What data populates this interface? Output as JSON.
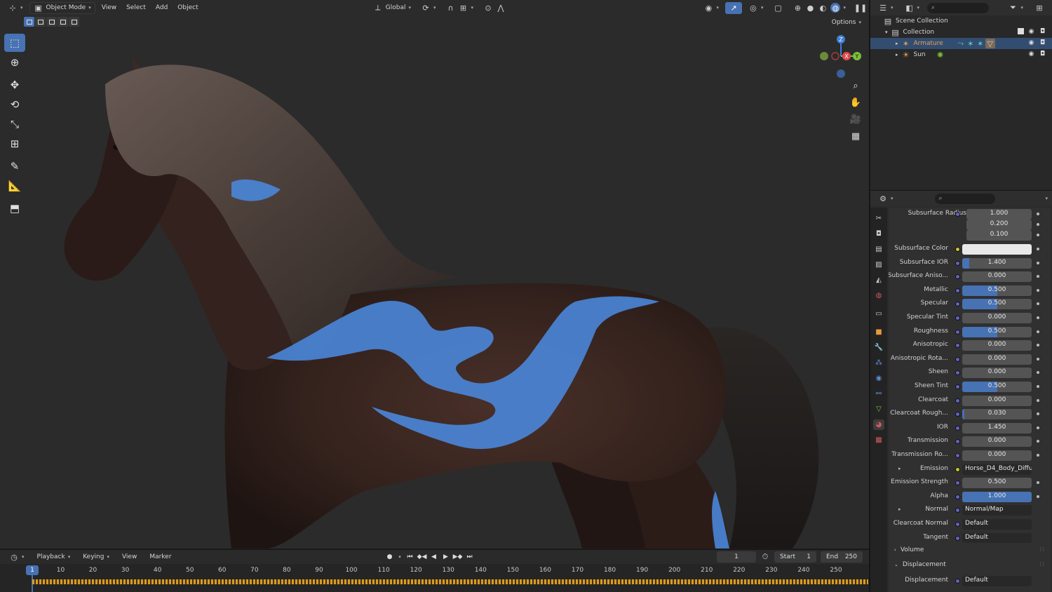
{
  "viewport": {
    "mode": "Object Mode",
    "menus": [
      "View",
      "Select",
      "Add",
      "Object"
    ],
    "orientation": "Global",
    "options_label": "Options",
    "gizmo": {
      "z": "Z",
      "x": "X",
      "y": "Y"
    }
  },
  "tools": [
    "select-box",
    "cursor",
    "move",
    "rotate",
    "scale",
    "transform",
    "annotate",
    "measure",
    "add-cube"
  ],
  "timeline": {
    "menus": [
      "Playback",
      "Keying",
      "View",
      "Marker"
    ],
    "current_frame": "1",
    "start_label": "Start",
    "start_value": "1",
    "end_label": "End",
    "end_value": "250",
    "frame_ticks": [
      "10",
      "20",
      "30",
      "40",
      "50",
      "60",
      "70",
      "80",
      "90",
      "100",
      "110",
      "120",
      "130",
      "140",
      "150",
      "160",
      "170",
      "180",
      "190",
      "200",
      "210",
      "220",
      "230",
      "240",
      "250"
    ]
  },
  "outliner": {
    "scene_collection": "Scene Collection",
    "collection": "Collection",
    "armature": "Armature",
    "sun": "Sun"
  },
  "properties": {
    "subsurface_radius_label": "Subsurface Radius",
    "subsurface_radius": [
      "1.000",
      "0.200",
      "0.100"
    ],
    "rows": [
      {
        "label": "Subsurface Color",
        "value": "",
        "kind": "color",
        "dot": "yellow"
      },
      {
        "label": "Subsurface IOR",
        "value": "1.400",
        "fill": 0.1
      },
      {
        "label": "Subsurface Aniso...",
        "value": "0.000",
        "fill": 0
      },
      {
        "label": "Metallic",
        "value": "0.500",
        "fill": 0.5
      },
      {
        "label": "Specular",
        "value": "0.500",
        "fill": 0.5
      },
      {
        "label": "Specular Tint",
        "value": "0.000",
        "fill": 0
      },
      {
        "label": "Roughness",
        "value": "0.500",
        "fill": 0.5
      },
      {
        "label": "Anisotropic",
        "value": "0.000",
        "fill": 0
      },
      {
        "label": "Anisotropic Rota...",
        "value": "0.000",
        "fill": 0
      },
      {
        "label": "Sheen",
        "value": "0.000",
        "fill": 0
      },
      {
        "label": "Sheen Tint",
        "value": "0.500",
        "fill": 0.5
      },
      {
        "label": "Clearcoat",
        "value": "0.000",
        "fill": 0
      },
      {
        "label": "Clearcoat Rough...",
        "value": "0.030",
        "fill": 0.03
      },
      {
        "label": "IOR",
        "value": "1.450",
        "fill": 0
      },
      {
        "label": "Transmission",
        "value": "0.000",
        "fill": 0
      },
      {
        "label": "Transmission Ro...",
        "value": "0.000",
        "fill": 0
      },
      {
        "label": "Emission",
        "value": "Horse_D4_Body_Diffuse",
        "kind": "link",
        "dot": "yellow",
        "expand": true
      },
      {
        "label": "Emission Strength",
        "value": "0.500",
        "fill": 0
      },
      {
        "label": "Alpha",
        "value": "1.000",
        "fill": 1
      },
      {
        "label": "Normal",
        "value": "Normal/Map",
        "kind": "link",
        "expand": true
      },
      {
        "label": "Clearcoat Normal",
        "value": "Default",
        "kind": "link"
      },
      {
        "label": "Tangent",
        "value": "Default",
        "kind": "link"
      }
    ],
    "section_volume": "Volume",
    "section_displacement": "Displacement",
    "displacement_label": "Displacement",
    "displacement_value": "Default"
  },
  "colors": {
    "accent": "#4772b3",
    "glow": "#4a86d9",
    "coat": "#3a2620",
    "keyframe": "#e3a21a"
  }
}
